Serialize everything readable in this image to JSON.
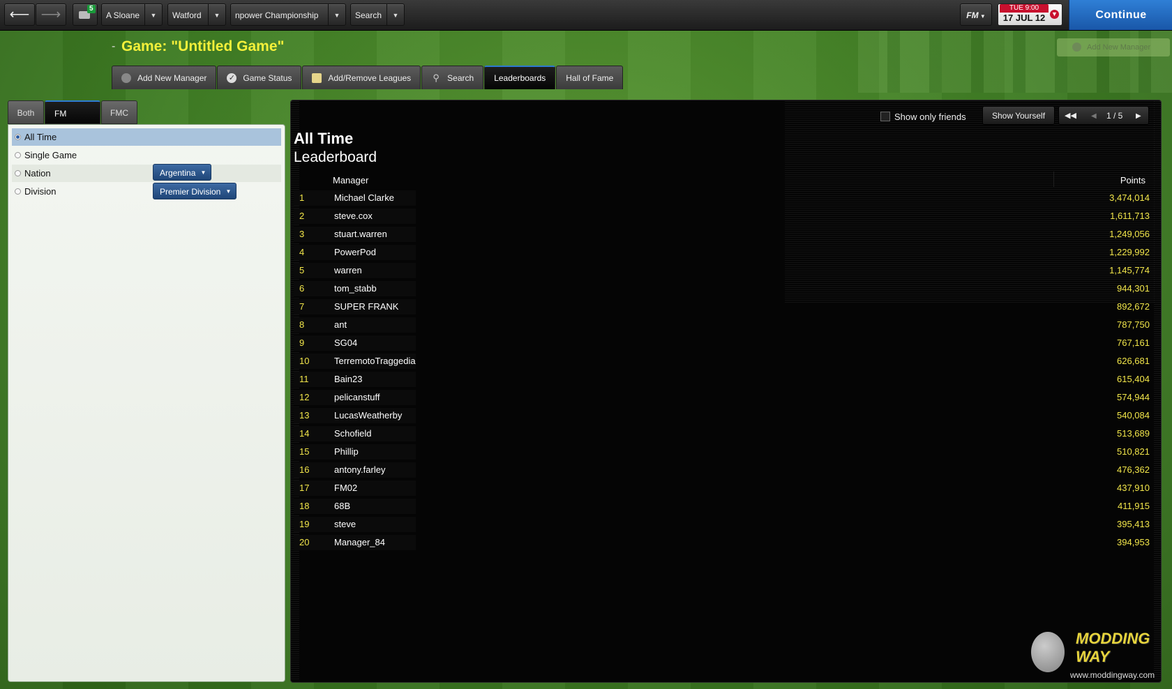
{
  "topbar": {
    "back_icon": "arrow-left-icon",
    "forward_icon": "arrow-right-icon",
    "inbox_count": "5",
    "manager_label": "A Sloane",
    "club_label": "Watford",
    "league_label": "npower Championship",
    "search_label": "Search",
    "fm_label": "FM",
    "date_day": "TUE 9:00",
    "date_date": "17 JUL 12",
    "continue_label": "Continue"
  },
  "header": {
    "title": "Game: \"Untitled Game\"",
    "add_new_manager_label": "Add New Manager"
  },
  "tabs": [
    {
      "label": "Add New Manager",
      "icon": "add-user-icon"
    },
    {
      "label": "Game Status",
      "icon": "check-icon"
    },
    {
      "label": "Add/Remove Leagues",
      "icon": "notepad-icon"
    },
    {
      "label": "Search",
      "icon": "search-icon"
    },
    {
      "label": "Leaderboards",
      "active": true
    },
    {
      "label": "Hall of Fame"
    }
  ],
  "subtabs": [
    {
      "label": "Both"
    },
    {
      "label": "FM",
      "active": true
    },
    {
      "label": "FMC"
    }
  ],
  "filters": {
    "options": [
      {
        "label": "All Time",
        "selected": true
      },
      {
        "label": "Single Game"
      },
      {
        "label": "Nation"
      },
      {
        "label": "Division"
      }
    ],
    "nation_value": "Argentina",
    "division_value": "Premier Division"
  },
  "leaderboard": {
    "title": "All Time",
    "subtitle": "Leaderboard",
    "show_only_friends_label": "Show only friends",
    "show_yourself_label": "Show Yourself",
    "page_indicator": "1 / 5",
    "col_manager": "Manager",
    "col_points": "Points",
    "rows": [
      {
        "rank": "1",
        "manager": "Michael Clarke",
        "points": "3,474,014"
      },
      {
        "rank": "2",
        "manager": "steve.cox",
        "points": "1,611,713"
      },
      {
        "rank": "3",
        "manager": "stuart.warren",
        "points": "1,249,056"
      },
      {
        "rank": "4",
        "manager": "PowerPod",
        "points": "1,229,992"
      },
      {
        "rank": "5",
        "manager": "warren",
        "points": "1,145,774"
      },
      {
        "rank": "6",
        "manager": "tom_stabb",
        "points": "944,301"
      },
      {
        "rank": "7",
        "manager": "SUPER FRANK",
        "points": "892,672"
      },
      {
        "rank": "8",
        "manager": "ant",
        "points": "787,750"
      },
      {
        "rank": "9",
        "manager": "SG04",
        "points": "767,161"
      },
      {
        "rank": "10",
        "manager": "TerremotoTraggedia",
        "points": "626,681"
      },
      {
        "rank": "11",
        "manager": "Bain23",
        "points": "615,404"
      },
      {
        "rank": "12",
        "manager": "pelicanstuff",
        "points": "574,944"
      },
      {
        "rank": "13",
        "manager": "LucasWeatherby",
        "points": "540,084"
      },
      {
        "rank": "14",
        "manager": "Schofield",
        "points": "513,689"
      },
      {
        "rank": "15",
        "manager": "Phillip",
        "points": "510,821"
      },
      {
        "rank": "16",
        "manager": "antony.farley",
        "points": "476,362"
      },
      {
        "rank": "17",
        "manager": "FM02",
        "points": "437,910"
      },
      {
        "rank": "18",
        "manager": "68B",
        "points": "411,915"
      },
      {
        "rank": "19",
        "manager": "steve",
        "points": "395,413"
      },
      {
        "rank": "20",
        "manager": "Manager_84",
        "points": "394,953"
      }
    ]
  },
  "watermark": {
    "logo": "MODDING WAY",
    "url": "www.moddingway.com"
  },
  "colors": {
    "accent_blue": "#2e7ad1",
    "title_yellow": "#f4f03a",
    "rank_yellow": "#f2e64a",
    "date_red": "#c8102e"
  }
}
